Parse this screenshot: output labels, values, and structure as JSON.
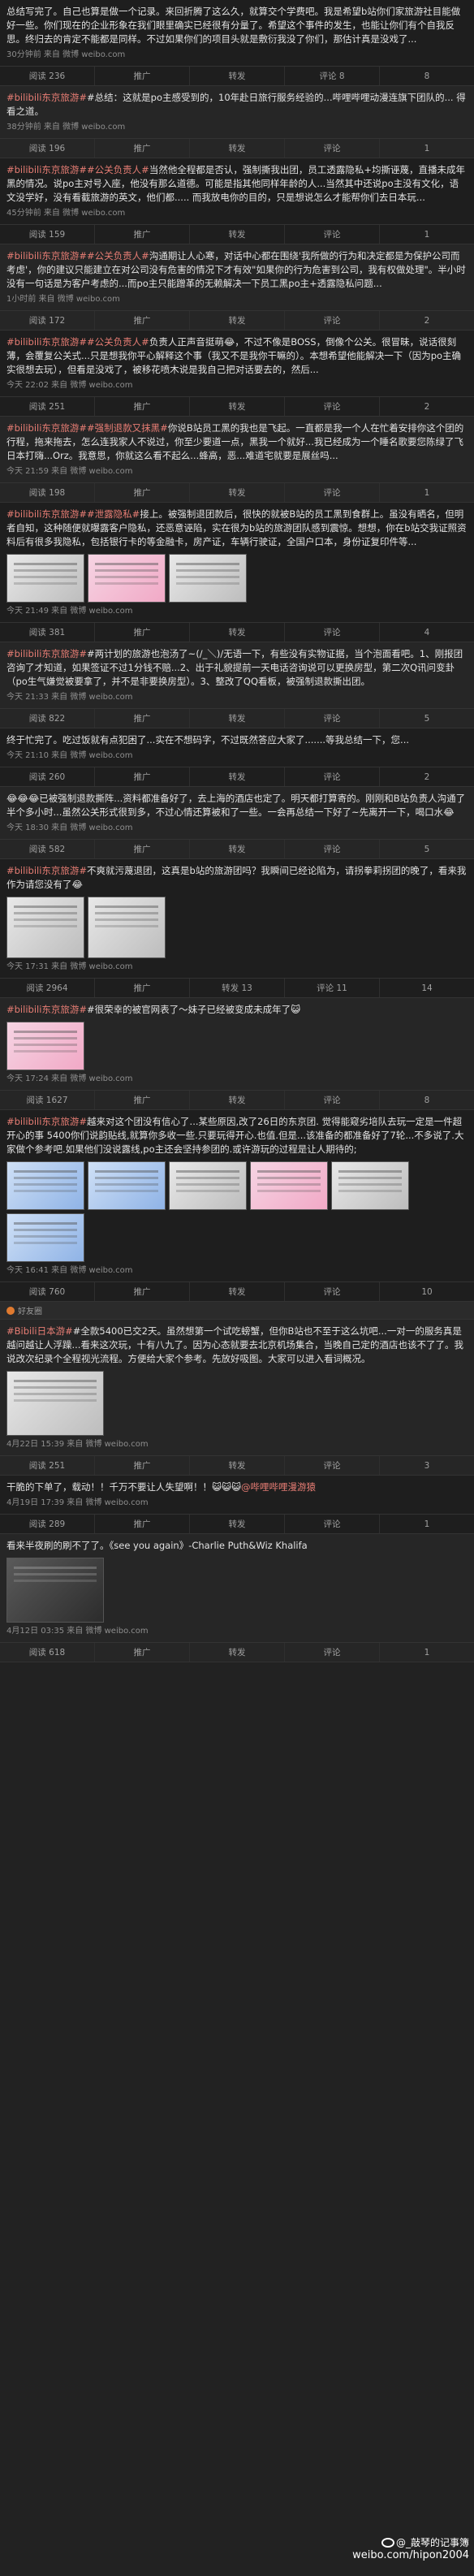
{
  "labels": {
    "repost": "转发",
    "comment": "评论",
    "like_prefix": "",
    "watermark_user": "@_敲琴的记事簿",
    "watermark_url": "weibo.com/hipon2004"
  },
  "posts": [
    {
      "text": "总结写完了。自己也算是做一个记录。来回折腾了这么久，就算交个学费吧。我是希望b站你们家旅游社目能做好一些。你们现在的企业形象在我们眼里确实已经很有分量了。希望这个事件的发生，也能让你们有个自我反思。终归去的肯定不能都是同样。不过如果你们的项目头就是敷衍我没了你们，那估计真是没戏了...",
      "meta": "30分钟前 来自 微博 weibo.com",
      "actions": [
        "阅读 236",
        "推广",
        "转发",
        "评论 8",
        "8"
      ]
    },
    {
      "text": "#bilibili东京旅游##总结：这就是po主感受到的，10年赴日旅行服务经验的...哔哩哔哩动漫连旗下团队的... 得看之道。",
      "meta": "38分钟前 来自 微博 weibo.com",
      "actions": [
        "阅读 196",
        "推广",
        "转发",
        "评论",
        "1"
      ]
    },
    {
      "text": "#bilibili东京旅游##公关负责人#当然他全程都是否认，强制撕我出团，员工透露隐私+均撕诬蔑，直播未成年黑的情况。说po主对号入座，他没有那么道德。可能是指其他同样年龄的人...当然其中还说po主没有文化，语文没学好，没有看截旅游的英文，他们都..... 而我放电你的目的，只是想说怎么才能帮你们去日本玩...",
      "meta": "45分钟前 来自 微博 weibo.com",
      "actions": [
        "阅读 159",
        "推广",
        "转发",
        "评论",
        "1"
      ]
    },
    {
      "text": "#bilibili东京旅游##公关负责人#沟通期让人心寒，对话中心都在围绕'我所做的行为和决定都是为保护公司而考虑'，你的建议只能建立在对公司没有危害的情况下才有效\"如果你的行为危害到公司，我有权做处理\"。半小时没有一句话是为客户考虑的...而po主只能蹭革的无赖解决一下员工黑po主+透露隐私问题...",
      "meta": "1小时前 来自 微博 weibo.com",
      "actions": [
        "阅读 172",
        "推广",
        "转发",
        "评论",
        "2"
      ]
    },
    {
      "text": "#bilibili东京旅游##公关负责人#负责人正声音挺萌😂，不过不像是BOSS，倒像个公关。很冒昧，说话很刻薄，会覆复公关式...只是想我你平心解释这个事（我又不是我你干嘛的）。本想希望他能解决一下（因为po主确实很想去玩），但看是没戏了，被移花喷木说是我自己把对话要去的，然后...",
      "meta": "今天 22:02 来自 微博 weibo.com",
      "actions": [
        "阅读 251",
        "推广",
        "转发",
        "评论",
        "2"
      ]
    },
    {
      "text": "#bilibili东京旅游##强制退款又抹黑#你说B站员工黑的我也是飞起。一直都是我一个人在忙着安排你这个团的行程，拖来拖去，怎么连我家人不说过，你至少要道一点，黑我一个就好...我已经成为一个睡名歌要您陈绿了飞日本打嗨...Orz。我意思，你就这么看不起么...蜂高，恶...难道宅就要是展丝吗...",
      "meta": "今天 21:59 来自 微博 weibo.com",
      "actions": [
        "阅读 198",
        "推广",
        "转发",
        "评论",
        "1"
      ]
    },
    {
      "text": "#bilibili东京旅游##泄露隐私#接上。被强制退团款后，很快的就被B站的员工黑到食群上。虽没有晒名，但明者自知，这种随便就曝露客户隐私，还恶意诬陷，实在很为b站的旅游团队感到震惊。想想，你在b站交我证照资料后有很多我隐私，包括银行卡的等金融卡，房产证，车辆行驶证，全国户口本，身份证复印件等...",
      "meta": "今天 21:49 来自 微博 weibo.com",
      "actions": [
        "阅读 381",
        "推广",
        "转发",
        "评论",
        "4"
      ]
    },
    {
      "text": "#bilibili东京旅游##两计划的旅游也泡汤了~(/_＼)/无语一下，有些没有实物证据，当个泡面看吧。1、刚报团咨询了才知道，如果签证不过1分钱不赔...2、出于礼貌提前一天电话咨询说可以更换房型，第二次Q讯问变卦（po生气嫌觉被要拿了，并不是非要换房型）。3、整改了QQ看板，被强制退款撕出团。",
      "meta": "今天 21:33 来自 微博 weibo.com",
      "actions": [
        "阅读 822",
        "推广",
        "转发",
        "评论",
        "5"
      ]
    },
    {
      "text": "终于忙完了。吃过饭就有点犯困了...实在不想码字，不过既然答应大家了.......等我总结一下，您...",
      "meta": "今天 21:10 来自 微博 weibo.com",
      "actions": [
        "阅读 260",
        "推广",
        "转发",
        "评论",
        "2"
      ]
    },
    {
      "text": "😂😂😂已被强制退款撕阵...资料都准备好了，去上海的酒店也定了。明天都打算寄的。刚刚和B站负责人沟通了半个多小时...虽然公关形式很到多，不过心情还算被和了一些。一会再总结一下好了~先离开一下，喝口水😂",
      "meta": "今天 18:30 来自 微博 weibo.com",
      "actions": [
        "阅读 582",
        "推广",
        "转发",
        "评论",
        "5"
      ]
    },
    {
      "text": "#bilibili东京旅游#不爽就污蔑退团，这真是b站的旅游团吗？我瞬间已经论陷为，请拐拳莉拐团的晚了，看来我作为请您没有了😂",
      "meta": "今天 17:31 来自 微博 weibo.com",
      "actions": [
        "阅读 2964",
        "推广",
        "转发 13",
        "评论 11",
        "14"
      ]
    },
    {
      "text": "#bilibili东京旅游##很荣幸的被官网表了～妹子已经被变成未成年了😺",
      "meta": "今天 17:24 来自 微博 weibo.com",
      "actions": [
        "阅读 1627",
        "推广",
        "转发",
        "评论",
        "8"
      ]
    },
    {
      "text": "#bilibili东京旅游#越来对这个团没有信心了...某些原因,改了26日的东京团. 觉得能窥劣培队去玩一定是一件超开心的事 5400你们说韵贴线,就算你多收一些.只要玩得开心.也值.但是...该准备的都准备好了7轮...不多说了.大家做个参考吧.如果他们没说露线,po主还会坚持参团的.或许游玩的过程是让人期待的;",
      "meta": "今天 16:41 来自 微博 weibo.com",
      "actions": [
        "阅读 760",
        "推广",
        "转发",
        "评论",
        "10"
      ]
    },
    {
      "text": "#Bibili日本游##全款5400已交2天。虽然想第一个试吃螃蟹，但你B站也不至于这么坑吧...一对一的服务真是越问越让人浮躁...看来这次玩，十有八九了。因为心态就要去北京机场集合，当晚自己定的酒店也该不了了。我说改次纪录个全程视光流程。方便给大家个参考。先放好吸图。大家可以进入看词概况。",
      "meta": "4月22日 15:39 来自 微博 weibo.com",
      "actions": [
        "阅读 251",
        "推广",
        "转发",
        "评论",
        "3"
      ]
    },
    {
      "text": "干脆的下单了，载动！！千万不要让人失望啊！！😺😺😺@哔哩哔哩漫游猿",
      "meta": "4月19日 17:39 来自 微博 weibo.com",
      "actions": [
        "阅读 289",
        "推广",
        "转发",
        "评论",
        "1"
      ]
    },
    {
      "text": "看来半夜刷的刷不了了。《see you again》-Charlie Puth&Wiz Khalifa",
      "meta": "4月12日 03:35 来自 微博 weibo.com",
      "actions": [
        "阅读 618",
        "推广",
        "转发",
        "评论",
        "1"
      ]
    }
  ],
  "banner": "好友圈"
}
